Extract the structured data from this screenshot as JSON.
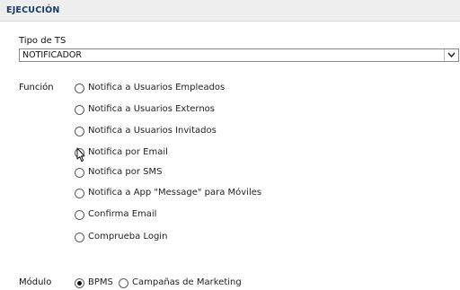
{
  "section": {
    "title": "EJECUCIÓN"
  },
  "tipo_ts": {
    "label": "Tipo de TS",
    "value": "NOTIFICADOR"
  },
  "funcion": {
    "label": "Función",
    "options": [
      {
        "label": "Notifica a Usuarios Empleados",
        "checked": false
      },
      {
        "label": "Notifica a Usuarios Externos",
        "checked": false
      },
      {
        "label": "Notifica a Usuarios Invitados",
        "checked": false
      },
      {
        "label": "Notifica por Email",
        "checked": true
      },
      {
        "label": "Notifica por SMS",
        "checked": false
      },
      {
        "label": "Notifica a App \"Message\" para Móviles",
        "checked": false
      },
      {
        "label": "Confirma Email",
        "checked": false
      },
      {
        "label": "Comprueba Login",
        "checked": false
      }
    ]
  },
  "modulo": {
    "label": "Módulo",
    "options": [
      {
        "label": "BPMS",
        "checked": true
      },
      {
        "label": "Campañas de Marketing",
        "checked": false
      }
    ]
  }
}
